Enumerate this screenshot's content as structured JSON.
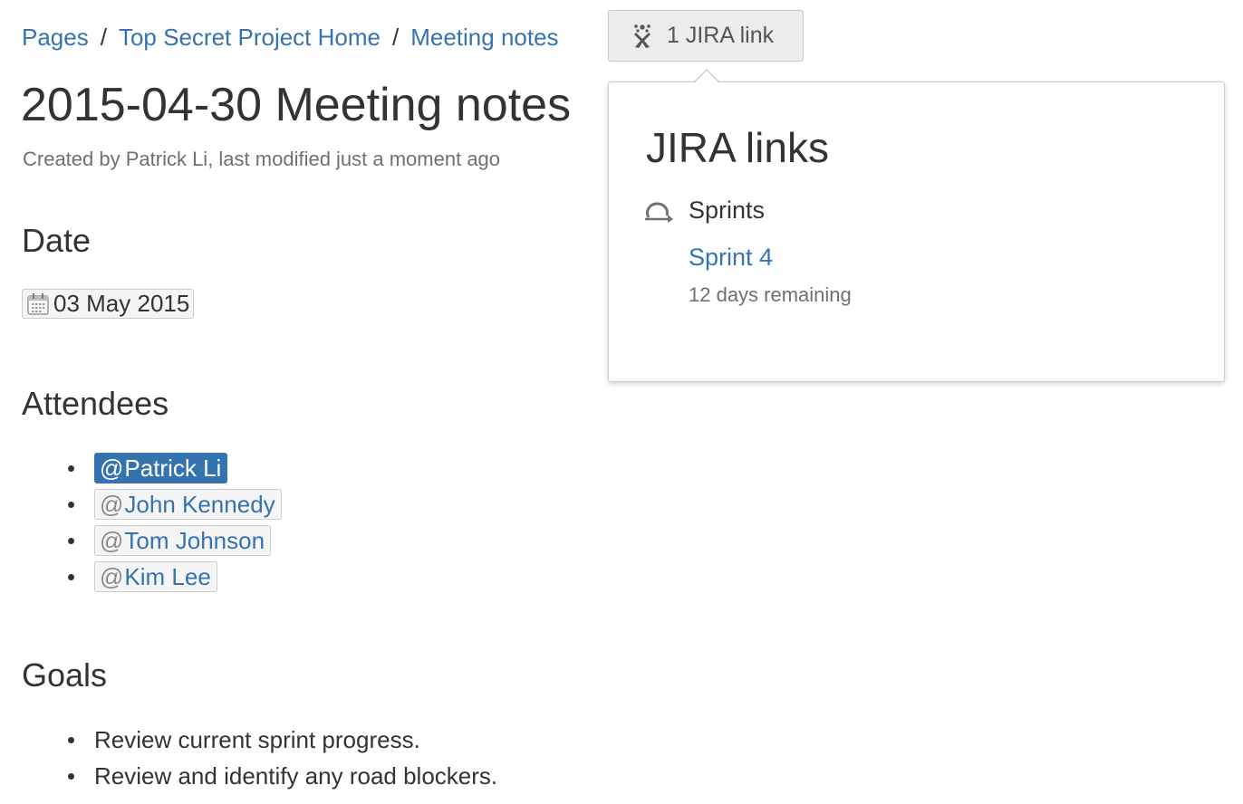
{
  "breadcrumb": {
    "items": [
      "Pages",
      "Top Secret Project Home",
      "Meeting notes"
    ],
    "separator": "/"
  },
  "jira_button": {
    "label": "1 JIRA link",
    "icon": "jira-icon"
  },
  "page": {
    "title": "2015-04-30 Meeting notes",
    "byline": "Created by Patrick Li, last modified just a moment ago"
  },
  "sections": {
    "date": {
      "heading": "Date",
      "value": "03 May 2015",
      "icon": "calendar-icon"
    },
    "attendees": {
      "heading": "Attendees",
      "items": [
        {
          "at": "@",
          "name": "Patrick Li",
          "current_user": true
        },
        {
          "at": "@",
          "name": "John Kennedy",
          "current_user": false
        },
        {
          "at": "@",
          "name": "Tom Johnson",
          "current_user": false
        },
        {
          "at": "@",
          "name": "Kim Lee",
          "current_user": false
        }
      ]
    },
    "goals": {
      "heading": "Goals",
      "items": [
        "Review current sprint progress.",
        "Review and identify any road blockers."
      ]
    }
  },
  "jira_popup": {
    "title": "JIRA links",
    "group": {
      "label": "Sprints",
      "icon": "sprint-icon"
    },
    "sprint": {
      "name": "Sprint 4",
      "remaining": "12 days remaining"
    }
  },
  "colors": {
    "link": "#3572b0",
    "text": "#333333",
    "muted": "#707070",
    "lozenge_bg": "#f5f5f5",
    "button_bg": "#ececec"
  }
}
